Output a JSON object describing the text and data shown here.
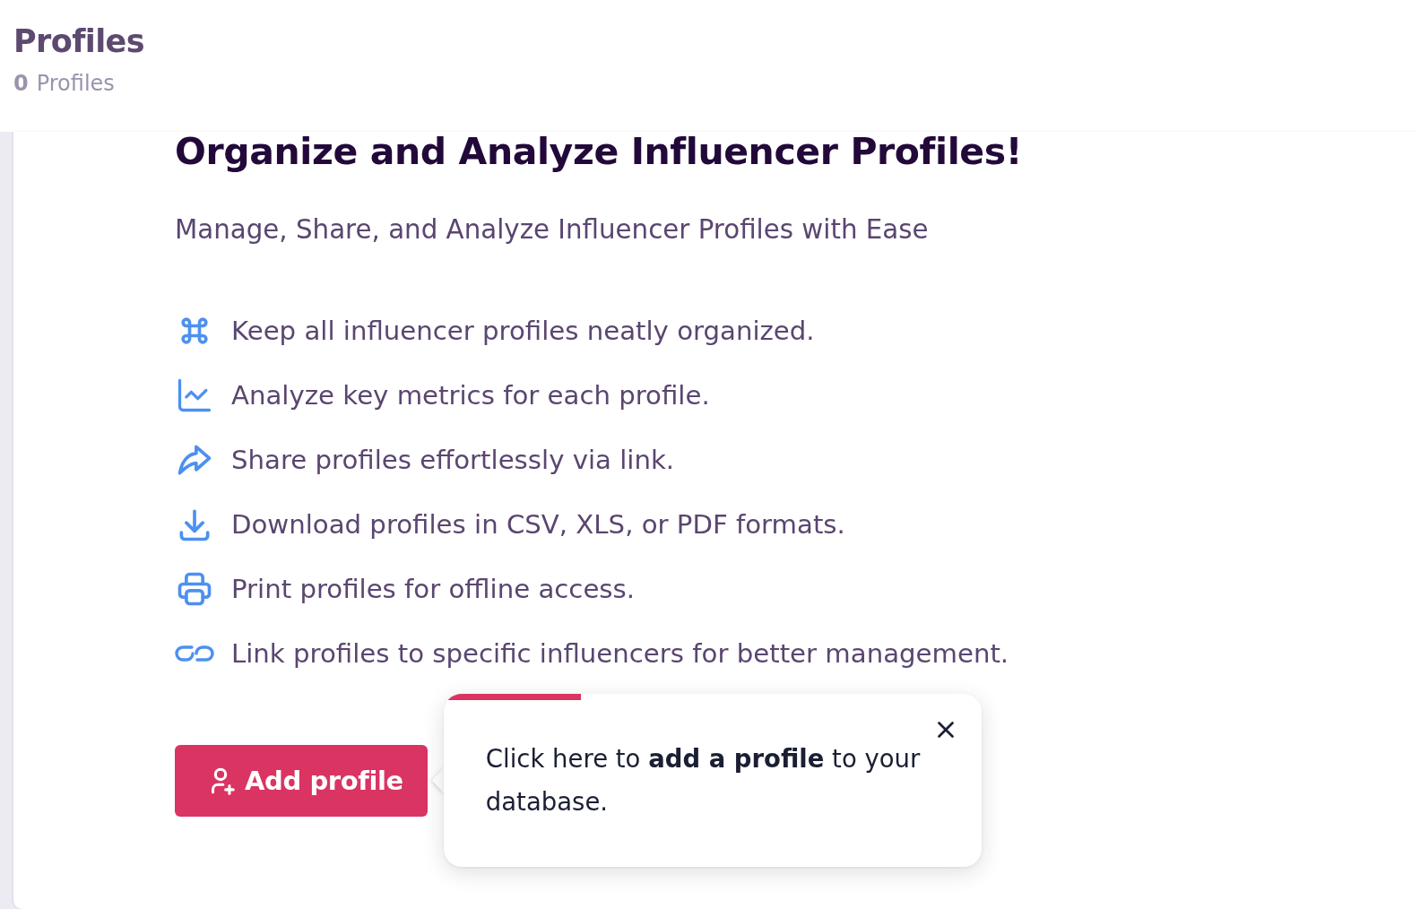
{
  "header": {
    "title": "Profiles",
    "count": "0",
    "count_label": "Profiles"
  },
  "intro": {
    "title": "Organize and Analyze Influencer Profiles!",
    "subtitle": "Manage, Share, and Analyze Influencer Profiles with Ease"
  },
  "features": [
    "Keep all influencer profiles neatly organized.",
    "Analyze key metrics for each profile.",
    "Share profiles effortlessly via link.",
    "Download profiles in CSV, XLS, or PDF formats.",
    "Print profiles for offline access.",
    "Link profiles to specific influencers for better management."
  ],
  "add_button": {
    "label": "Add profile"
  },
  "tour_tooltip": {
    "progress": {
      "level": 0.25
    },
    "text": "Click here to **add a profile** to your database."
  }
}
